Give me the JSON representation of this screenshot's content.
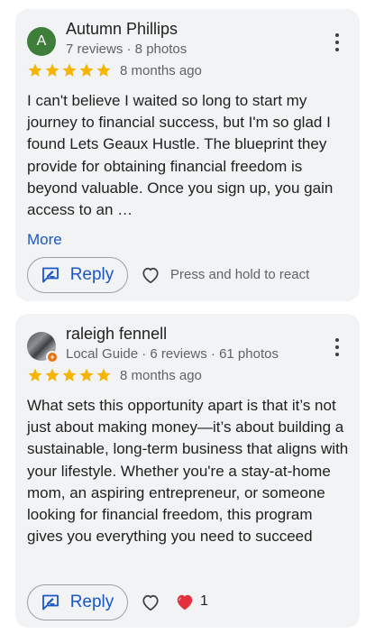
{
  "reviews": [
    {
      "avatar_letter": "A",
      "avatar_color": "#3f7d3a",
      "name": "Autumn Phillips",
      "meta": "7 reviews · 8 photos",
      "rating": 5,
      "time_ago": "8 months ago",
      "text": "I can't believe I waited so long to start my journey to financial success, but I'm so glad I found Lets Geaux Hustle. The blueprint they provide for obtaining financial freedom is beyond valuable. Once you sign up, you gain access to an …",
      "more_label": "More",
      "reply_label": "Reply",
      "react_hint": "Press and hold to react"
    },
    {
      "avatar_icon": "profile-photo",
      "name": "raleigh fennell",
      "meta": "Local Guide · 6 reviews · 61 photos",
      "rating": 5,
      "time_ago": "8 months ago",
      "text": "What sets this opportunity apart is that it’s not just about making money—it’s about building a sustainable, long-term business that aligns with your lifestyle. Whether you're a stay-at-home mom, an aspiring entrepreneur, or someone looking for financial freedom, this program gives you everything you need to succeed",
      "reply_label": "Reply",
      "reaction_icon": "red-heart",
      "reaction_count": "1"
    }
  ],
  "colors": {
    "card_bg": "#f1f3f4",
    "star": "#f4b400",
    "link": "#1a56c4",
    "secondary_text": "#5f6368",
    "reaction_heart": "#e2303d"
  }
}
